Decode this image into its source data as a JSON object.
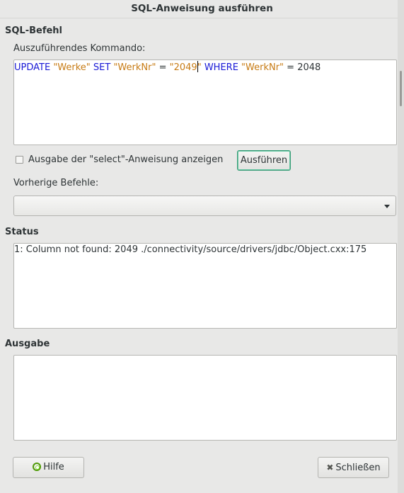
{
  "window": {
    "title": "SQL-Anweisung ausführen"
  },
  "sql_section": {
    "heading": "SQL-Befehl",
    "command_label": "Auszuführendes Kommando:",
    "command_tokens": {
      "t1": "UPDATE ",
      "t2": "\"Werke\"",
      "t3": " SET ",
      "t4": "\"WerkNr\"",
      "t5": " = ",
      "t6": "\"2049",
      "t7": "\"",
      "t8": " WHERE ",
      "t9": "\"WerkNr\"",
      "t10": " = 2048"
    },
    "show_select_output_label": "Ausgabe der \"select\"-Anweisung anzeigen",
    "show_select_output_checked": false,
    "execute_button": "Ausführen",
    "previous_label": "Vorherige Befehle:",
    "previous_selected": ""
  },
  "status_section": {
    "heading": "Status",
    "message": "1: Column not found: 2049 ./connectivity/source/drivers/jdbc/Object.cxx:175"
  },
  "output_section": {
    "heading": "Ausgabe",
    "content": ""
  },
  "footer": {
    "help_button": "Hilfe",
    "close_button": "Schließen"
  },
  "colors": {
    "keyword": "#1a1ad6",
    "string": "#c77b14",
    "focus_border": "#3b9c78"
  },
  "icons": {
    "help": "help-lifebuoy-icon",
    "close": "close-x-icon",
    "dropdown": "chevron-down-icon"
  }
}
